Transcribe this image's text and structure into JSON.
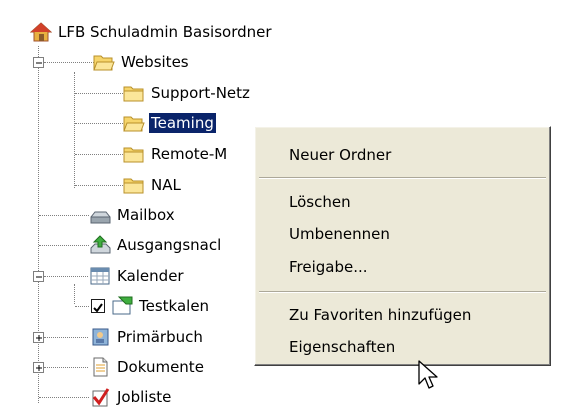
{
  "tree": {
    "root": "LFB Schuladmin Basisordner",
    "websites": "Websites",
    "support_netz": "Support-Netz",
    "teaming": "Teaming",
    "remote": "Remote-M",
    "nal": "NAL",
    "mailbox": "Mailbox",
    "ausgang": "Ausgangsnacl",
    "kalender": "Kalender",
    "testkalender": "Testkalen",
    "primarbuch": "Primärbuch",
    "dokumente": "Dokumente",
    "jobliste": "Jobliste"
  },
  "context_menu": {
    "new_folder": "Neuer Ordner",
    "delete": "Löschen",
    "rename": "Umbenennen",
    "share": "Freigabe...",
    "add_favorites": "Zu Favoriten hinzufügen",
    "properties": "Eigenschaften"
  },
  "colors": {
    "selection": "#0a246a",
    "menu_bg": "#ece9d8",
    "folder": "#f6d56b"
  }
}
